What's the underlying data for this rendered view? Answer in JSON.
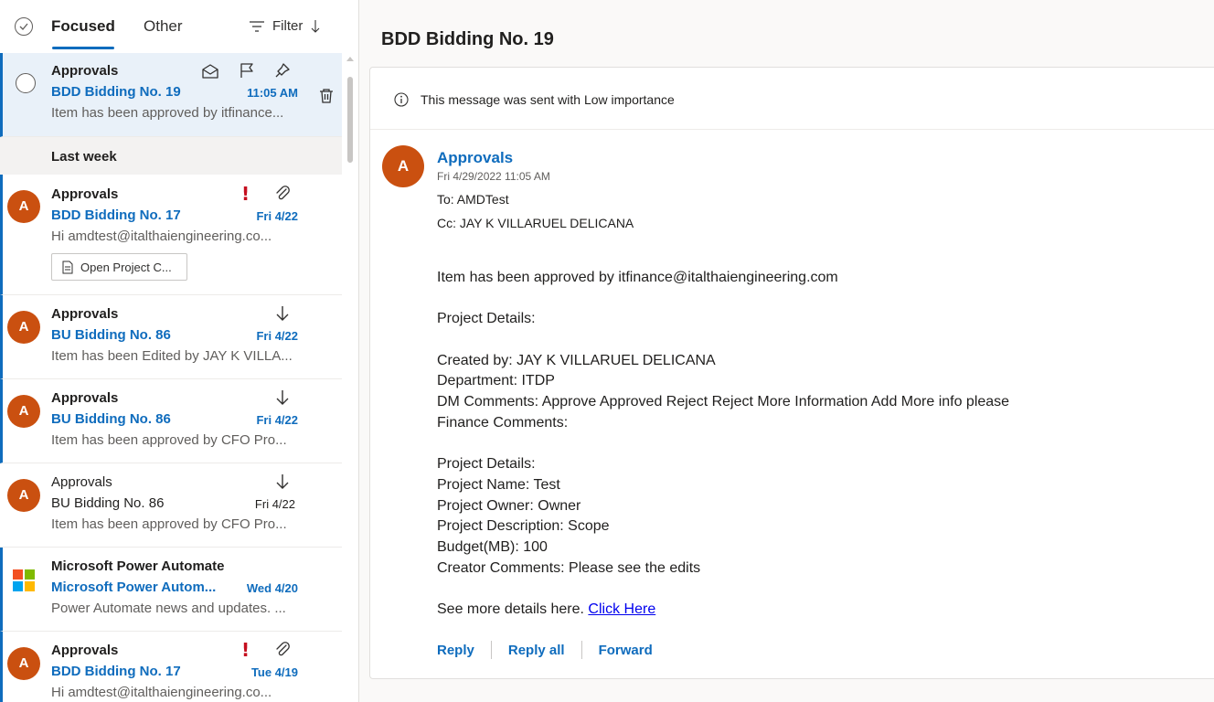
{
  "list": {
    "tabs": {
      "focused": "Focused",
      "other": "Other"
    },
    "filter_label": "Filter",
    "selected_item": {
      "sender": "Approvals",
      "subject": "BDD Bidding No. 19",
      "time": "11:05 AM",
      "preview": "Item has been approved by itfinance..."
    },
    "group_header": "Last week",
    "items": [
      {
        "sender": "Approvals",
        "subject": "BDD Bidding No. 17",
        "time": "Fri 4/22",
        "preview": "Hi amdtest@italthaiengineering.co...",
        "attachment_label": "Open Project C...",
        "avatar": "A",
        "flags": [
          "high-importance",
          "attachment"
        ]
      },
      {
        "sender": "Approvals",
        "subject": "BU Bidding No. 86",
        "time": "Fri 4/22",
        "preview": "Item has been Edited by JAY K VILLA...",
        "avatar": "A",
        "flags": [
          "low-importance"
        ]
      },
      {
        "sender": "Approvals",
        "subject": "BU Bidding No. 86",
        "time": "Fri 4/22",
        "preview": "Item has been approved by CFO Pro...",
        "avatar": "A",
        "flags": [
          "low-importance"
        ]
      },
      {
        "sender": "Approvals",
        "subject": "BU Bidding No. 86",
        "time": "Fri 4/22",
        "preview": "Item has been approved by CFO Pro...",
        "avatar": "A",
        "read": true,
        "flags": [
          "low-importance"
        ]
      },
      {
        "sender": "Microsoft Power Automate",
        "subject": "Microsoft Power Autom...",
        "time": "Wed 4/20",
        "preview": "Power Automate news and updates. ...",
        "avatar": "microsoft-logo",
        "flags": []
      },
      {
        "sender": "Approvals",
        "subject": "BDD Bidding No. 17",
        "time": "Tue 4/19",
        "preview": "Hi amdtest@italthaiengineering.co...",
        "avatar": "A",
        "flags": [
          "high-importance",
          "attachment"
        ]
      }
    ]
  },
  "reading": {
    "title": "BDD Bidding No. 19",
    "importance_notice": "This message was sent with Low importance",
    "avatar": "A",
    "sender": "Approvals",
    "date": "Fri 4/29/2022 11:05 AM",
    "to": "To:  AMDTest",
    "cc": "Cc:  JAY K VILLARUEL DELICANA",
    "body": {
      "l1": "Item has been approved by itfinance@italthaiengineering.com",
      "l2": "Project Details:",
      "l3": "Created by: JAY K VILLARUEL DELICANA",
      "l4": "Department: ITDP",
      "l5": "DM Comments: Approve Approved Reject Reject More Information Add More info please",
      "l6": "Finance Comments:",
      "l7": "Project Details:",
      "l8": "Project Name: Test",
      "l9": "Project Owner: Owner",
      "l10": "Project Description: Scope",
      "l11": "Budget(MB): 100",
      "l12": "Creator Comments: Please see the edits",
      "l13_prefix": "See more details here. ",
      "l13_link": "Click Here"
    },
    "actions": {
      "reply": "Reply",
      "reply_all": "Reply all",
      "forward": "Forward"
    }
  },
  "colors": {
    "accent": "#0f6cbd",
    "avatar": "#ca5010",
    "importance": "#c50f1f"
  }
}
